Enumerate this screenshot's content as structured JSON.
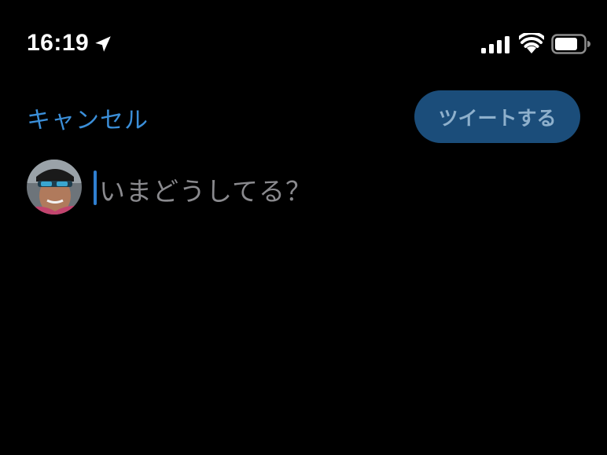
{
  "status_bar": {
    "time": "16:19",
    "icons": [
      "location-arrow-icon",
      "cellular-signal-icon",
      "wifi-icon",
      "battery-icon"
    ]
  },
  "header": {
    "cancel_label": "キャンセル",
    "tweet_label": "ツイートする"
  },
  "compose": {
    "placeholder": "いまどうしてる？",
    "text": ""
  },
  "colors": {
    "background": "#000000",
    "accent": "#3b8fd9",
    "tweet_button_bg": "#1b4d7a",
    "tweet_button_text": "#8eb0cc",
    "placeholder": "#8a8a8e"
  }
}
